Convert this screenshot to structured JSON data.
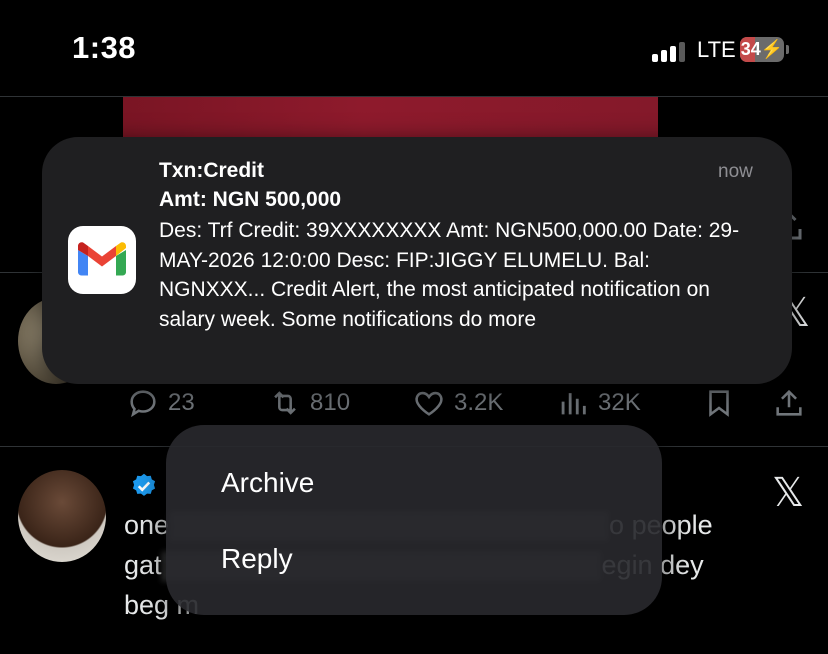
{
  "status_bar": {
    "time": "1:38",
    "network": "LTE",
    "battery": "34",
    "battery_level": 0.34
  },
  "feed": {
    "tweet1": {
      "actions": {
        "replies": "23",
        "retweets": "810",
        "likes": "3.2K",
        "views": "32K"
      }
    },
    "tweet2": {
      "text_visible_start": "one",
      "text_line1_end": "o people",
      "text_line2_start": "gat",
      "text_line2_end": "egin dey",
      "text_line3_start": "beg m"
    }
  },
  "notification": {
    "app_icon": "gmail-icon",
    "title": "Txn:Credit",
    "subtitle": "Amt: NGN 500,000",
    "time": "now",
    "body": "Des: Trf Credit: 39XXXXXXXX Amt: NGN500,000.00 Date: 29-MAY-2026 12:0:00 Desc: FIP:JIGGY ELUMELU. Bal: NGNXXX... Credit Alert, the most anticipated notification on salary week. Some notifications do more"
  },
  "context_menu": {
    "items": [
      {
        "label": "Archive"
      },
      {
        "label": "Reply"
      }
    ]
  },
  "colors": {
    "background": "#000000",
    "notification_bg": "#1f1f21",
    "muted": "#71767b",
    "verified": "#1d9bf0"
  }
}
